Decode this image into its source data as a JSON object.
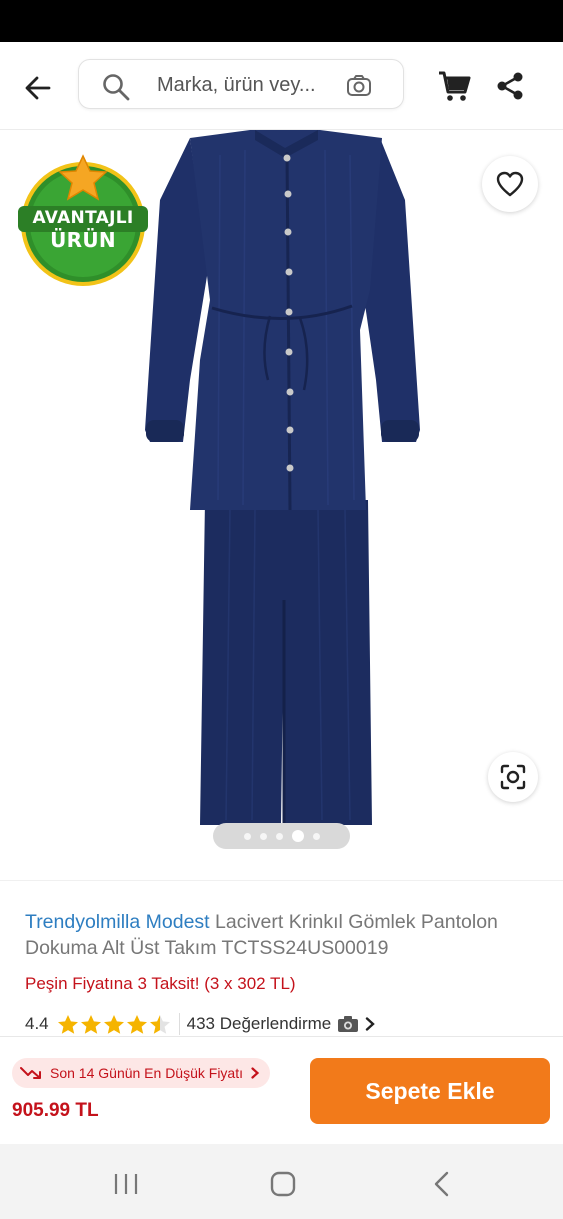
{
  "header": {
    "search_placeholder": "Marka, ürün vey..."
  },
  "badge": {
    "line1": "AVANTAJLI",
    "line2": "ÜRÜN"
  },
  "gallery": {
    "dot_count": 5,
    "active_index": 3
  },
  "product": {
    "brand": "Trendyolmilla Modest",
    "name": " Lacivert Krinkıl Gömlek Pantolon Dokuma Alt Üst Takım TCTSS24US00019",
    "installment": "Peşin Fiyatına 3 Taksit! (3 x 302 TL)",
    "rating": "4.4",
    "rating_value": 4.4,
    "reviews": "433 Değerlendirme"
  },
  "footer": {
    "lowest_price_badge": "Son 14 Günün En Düşük Fiyatı",
    "price": "905.99 TL",
    "add_to_cart": "Sepete Ekle"
  },
  "icons": {
    "back": "back-arrow-icon",
    "search": "search-icon",
    "camera": "camera-search-icon",
    "cart": "cart-icon",
    "share": "share-icon",
    "favorite": "heart-icon",
    "lens": "lens-icon"
  },
  "colors": {
    "accent_orange": "#f27a1a",
    "brand_blue": "#2e7ec1",
    "price_red": "#c4121b",
    "badge_green": "#3a9b2d",
    "star_yellow": "#f5b400",
    "garment_navy": "#1e2f63"
  }
}
